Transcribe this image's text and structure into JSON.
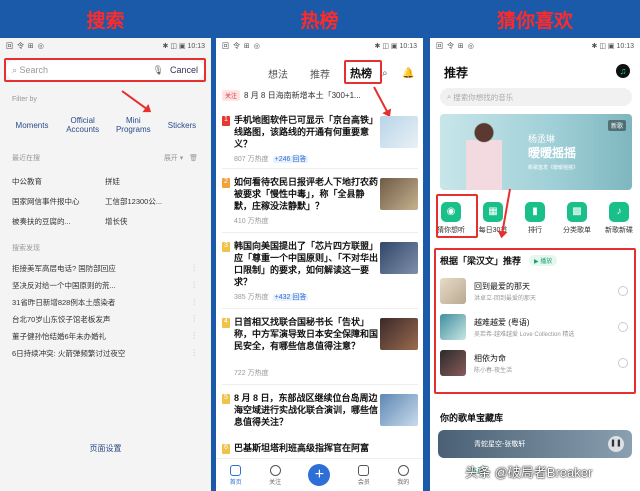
{
  "headers": [
    "搜索",
    "热榜",
    "猜你喜欢"
  ],
  "status": {
    "left": "回 令 ⊞ ◎",
    "right": "✱ ◫ ▣ 10:13"
  },
  "panel1": {
    "search_placeholder": "Search",
    "cancel": "Cancel",
    "filter_by": "Filter by",
    "filters": [
      "Moments",
      "Official Accounts",
      "Mini Programs",
      "Stickers"
    ],
    "recent_label": "最近在搜",
    "expand": "展开",
    "recent_items": [
      "中公教育",
      "拼娃",
      "国家网信事件报中心",
      "工信部12300公...",
      "被奏扶的豆腐的...",
      "增长侠"
    ],
    "discover_label": "搜索发现",
    "discover_items": [
      "拒接美军高层电话? 国防部回应",
      "坚决反对给一个中国原则的荒...",
      "31省昨日新增828例本土感染者",
      "台北70岁山东饺子馆老板发声",
      "董子健孙怡结婚6年未办婚礼",
      "6日持续冲突: 火箭弹频繁讨过夜空"
    ],
    "page_settings": "页面设置"
  },
  "panel2": {
    "tabs": [
      "想法",
      "推荐",
      "热榜"
    ],
    "ticker_tag": "关注",
    "ticker": "8 月 8 日海南新增本土「300+1...",
    "news": [
      {
        "rank": "1",
        "title": "手机地图软件已可显示「京台高铁」线路图，该路线的开通有何重要意义？",
        "heat": "807 万热度",
        "answers": "+246 回答"
      },
      {
        "rank": "2",
        "title": "如何看待农民日报评老人下地打农药被要求「慢性中毒」，称「全县静默，庄稼没法静默」？",
        "heat": "410 万热度",
        "answers": ""
      },
      {
        "rank": "3",
        "title": "韩国向美国提出了「芯片四方联盟」应「尊重一个中国原则」、「不对华出口限制」的要求，如何解读这一要求？",
        "heat": "385 万热度",
        "answers": "+432 回答"
      },
      {
        "rank": "4",
        "title": "日首相又找联合国秘书长「告状」称，中方军演导致日本安全保障和国民安全，有哪些信息值得注意？",
        "heat": "722 万热度",
        "answers": ""
      },
      {
        "rank": "5",
        "title": "8 月 8 日，东部战区继续位台岛周边海空域进行实战化联合演训，哪些信息值得关注？",
        "heat": "",
        "answers": ""
      },
      {
        "rank": "6",
        "title": "巴基斯坦塔利班高级指挥官在阿富",
        "heat": "",
        "answers": ""
      }
    ],
    "bottom_nav": [
      "首页",
      "关注",
      "",
      "会员",
      "我的"
    ]
  },
  "panel3": {
    "title": "推荐",
    "search_placeholder": "搜索你想找的音乐",
    "banner": {
      "artist": "杨丞琳",
      "song": "暧暧摇摇",
      "small": "新歌首发《暧暧摇摇》",
      "tag": "新歌"
    },
    "icons": [
      {
        "label": "猜你想听",
        "glyph": "◉"
      },
      {
        "label": "每日30首",
        "glyph": "▦"
      },
      {
        "label": "排行",
        "glyph": "▮"
      },
      {
        "label": "分类歌单",
        "glyph": "▩"
      },
      {
        "label": "新歌新碟",
        "glyph": "♪"
      }
    ],
    "section_title": "根据「梁汉文」推荐",
    "play_label": "▶ 播放",
    "songs": [
      {
        "name": "回到最爱的那天",
        "sub": "洪卓立-回到最爱的那天"
      },
      {
        "name": "越难越爱 (粤语)",
        "sub": "吴若希-越难越爱 Love Collection 精选"
      },
      {
        "name": "相依为命",
        "sub": "陈小春-夜生活"
      }
    ],
    "library_title": "你的歌单宝藏库",
    "player_text": "青蛇星空-张敬轩",
    "bottom_active": "首页"
  },
  "watermark": "头条 @破局者Breaker"
}
